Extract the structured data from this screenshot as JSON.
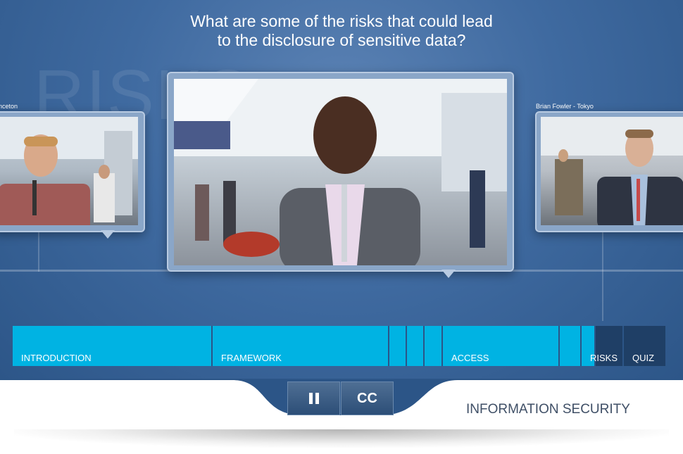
{
  "question": {
    "line1": "What are some of the risks that could lead",
    "line2": "to the disclosure of sensitive data?"
  },
  "background_words": {
    "top": "RISKS"
  },
  "videos": {
    "left_caption": "nceton",
    "right_caption": "Brian Fowler - Tokyo"
  },
  "nav": {
    "segments": [
      {
        "label": "INTRODUCTION"
      },
      {
        "label": "FRAMEWORK"
      },
      {
        "label": ""
      },
      {
        "label": ""
      },
      {
        "label": ""
      },
      {
        "label": "ACCESS"
      },
      {
        "label": ""
      },
      {
        "label": ""
      },
      {
        "label": "RISKS"
      },
      {
        "label": "QUIZ"
      }
    ]
  },
  "controls": {
    "pause_icon": "pause-icon",
    "cc_label": "CC"
  },
  "brand": {
    "title": "INFORMATION SECURITY"
  },
  "colors": {
    "accent": "#00b3e3",
    "inactive": "#1f3f66",
    "background": "#3f6aa0"
  }
}
